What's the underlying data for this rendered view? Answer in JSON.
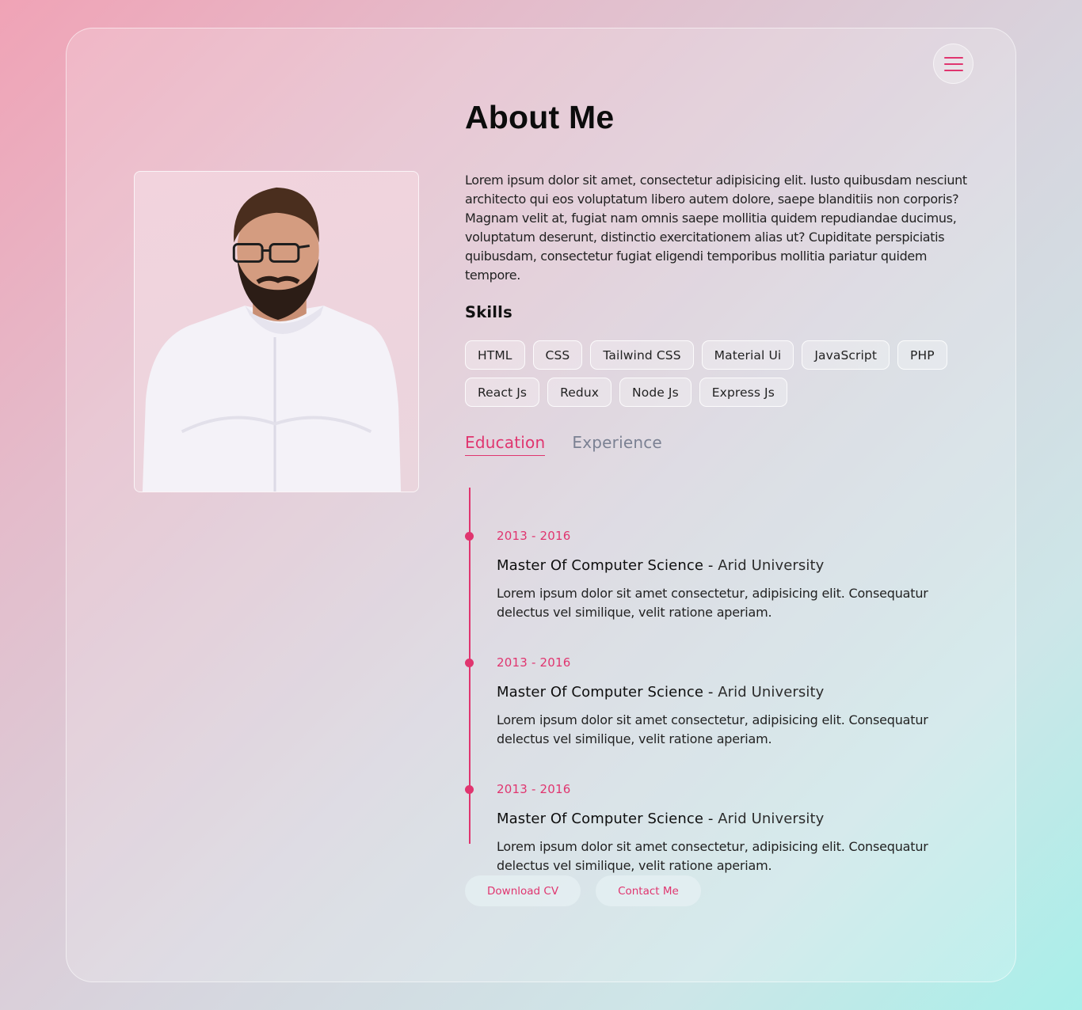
{
  "page": {
    "title": "About Me",
    "menu_icon": "hamburger-menu-icon"
  },
  "profile": {
    "photo_alt": "Profile photo"
  },
  "about": {
    "text": "Lorem ipsum dolor sit amet, consectetur adipisicing elit. Iusto quibusdam nesciunt architecto qui eos voluptatum libero autem dolore, saepe blanditiis non corporis? Magnam velit at, fugiat nam omnis saepe mollitia quidem repudiandae ducimus, voluptatum deserunt, distinctio exercitationem alias ut? Cupiditate perspiciatis quibusdam, consectetur fugiat eligendi temporibus mollitia pariatur quidem tempore."
  },
  "skills": {
    "title": "Skills",
    "items": [
      "HTML",
      "CSS",
      "Tailwind CSS",
      "Material Ui",
      "JavaScript",
      "PHP",
      "React Js",
      "Redux",
      "Node Js",
      "Express Js"
    ]
  },
  "tabs": {
    "active": "Education",
    "items": [
      {
        "label": "Education"
      },
      {
        "label": "Experience"
      }
    ]
  },
  "timeline": [
    {
      "date": "2013 - 2016",
      "degree": "Master Of Computer Science",
      "separator": " - ",
      "institution": "Arid University",
      "description": "Lorem ipsum dolor sit amet consectetur, adipisicing elit. Consequatur delectus vel similique, velit ratione aperiam."
    },
    {
      "date": "2013 - 2016",
      "degree": "Master Of Computer Science",
      "separator": " - ",
      "institution": "Arid University",
      "description": "Lorem ipsum dolor sit amet consectetur, adipisicing elit. Consequatur delectus vel similique, velit ratione aperiam."
    },
    {
      "date": "2013 - 2016",
      "degree": "Master Of Computer Science",
      "separator": " - ",
      "institution": "Arid University",
      "description": "Lorem ipsum dolor sit amet consectetur, adipisicing elit. Consequatur delectus vel similique, velit ratione aperiam."
    }
  ],
  "actions": {
    "download_cv": "Download CV",
    "contact_me": "Contact Me"
  },
  "colors": {
    "accent": "#e0356f",
    "muted_tab": "#7b8193"
  }
}
